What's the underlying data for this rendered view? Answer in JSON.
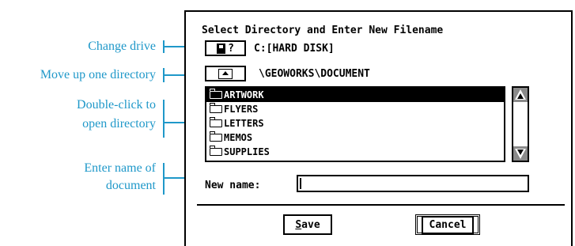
{
  "callouts": {
    "change_drive": "Change drive",
    "move_up": "Move up one directory",
    "double_click_line1": "Double-click to",
    "double_click_line2": "open directory",
    "enter_name_line1": "Enter name of",
    "enter_name_line2": "document"
  },
  "dialog": {
    "title": "Select Directory and Enter New Filename",
    "drive_button_label": "?",
    "drive_text": "C:[HARD DISK]",
    "path_text": "\\GEOWORKS\\DOCUMENT",
    "list_items": [
      {
        "label": "ARTWORK",
        "selected": true
      },
      {
        "label": "FLYERS",
        "selected": false
      },
      {
        "label": "LETTERS",
        "selected": false
      },
      {
        "label": "MEMOS",
        "selected": false
      },
      {
        "label": "SUPPLIES",
        "selected": false
      }
    ],
    "new_name_label": "New name:",
    "new_name_value": "",
    "save_label": "Save",
    "cancel_label": "Cancel"
  },
  "colors": {
    "callout": "#1f98c9",
    "scroll_arrow_bg": "#8a8a8a"
  },
  "icons": {
    "drive": "floppy-disk-icon",
    "up": "up-directory-icon",
    "folder": "folder-icon",
    "scroll_up": "scroll-up-arrow-icon",
    "scroll_down": "scroll-down-arrow-icon"
  }
}
